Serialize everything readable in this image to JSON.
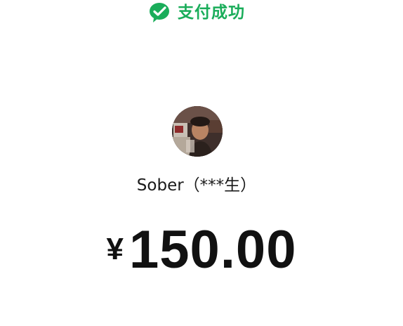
{
  "status": {
    "icon": "wechat-pay-check-icon",
    "text": "支付成功",
    "color": "#1aad5a"
  },
  "payee": {
    "avatar": "payee-avatar",
    "name": "Sober（***生）"
  },
  "amount": {
    "currency": "¥",
    "value": "150.00"
  }
}
